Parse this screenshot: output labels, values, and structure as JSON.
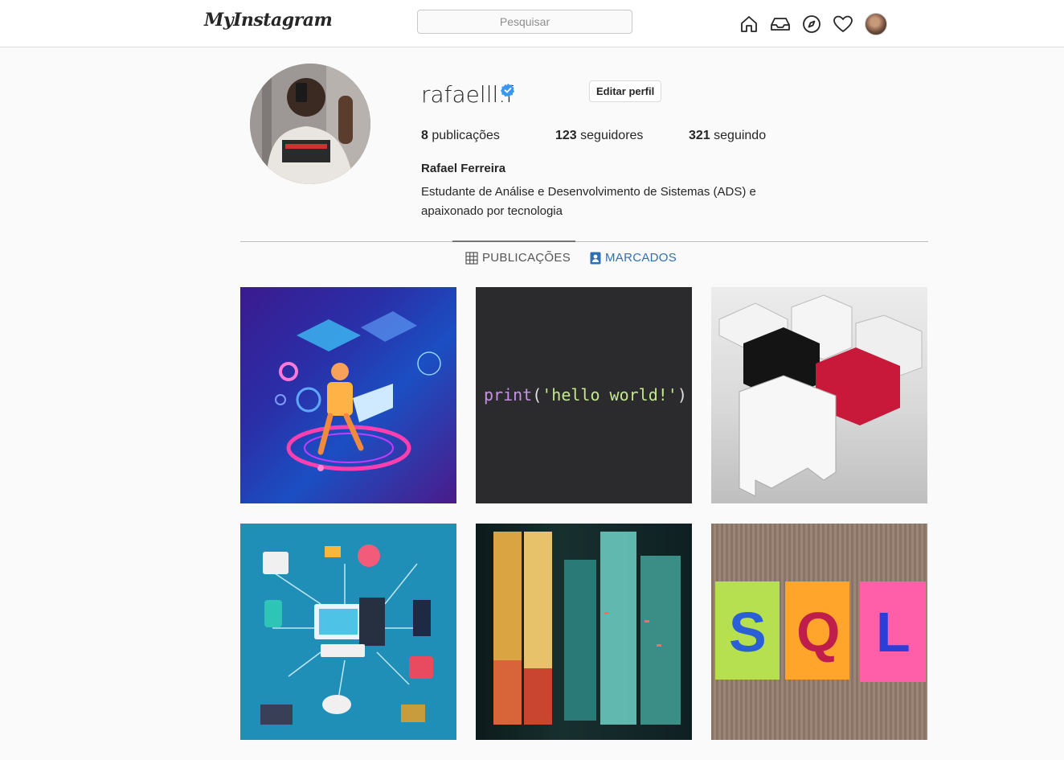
{
  "header": {
    "logo": "MyInstagram",
    "search_placeholder": "Pesquisar",
    "nav_icons": [
      "home-icon",
      "inbox-icon",
      "explore-icon",
      "heart-icon",
      "avatar"
    ]
  },
  "profile": {
    "username": "rafaelll.f",
    "edit_label": "Editar perfil",
    "stats": {
      "posts_count": "8",
      "posts_label": "publicações",
      "followers_count": "123",
      "followers_label": "seguidores",
      "following_count": "321",
      "following_label": "seguindo"
    },
    "full_name": "Rafael Ferreira",
    "bio": "Estudante de Análise e Desenvolvimento de Sistemas (ADS) e apaixonado por tecnologia"
  },
  "tabs": [
    {
      "label": "PUBLICAÇÕES",
      "active": true
    },
    {
      "label": "MARCADOS",
      "active": false
    }
  ],
  "posts": {
    "code_post": {
      "fn": "print",
      "open": "(",
      "str": "'hello world!'",
      "close": ")"
    },
    "sql_post": {
      "l1": "S",
      "l2": "Q",
      "l3": "L"
    }
  },
  "colors": {
    "accent_blue": "#2f6fb5",
    "verified_blue": "#3897f0",
    "text_primary": "#262626",
    "border": "#dbdbdb"
  }
}
